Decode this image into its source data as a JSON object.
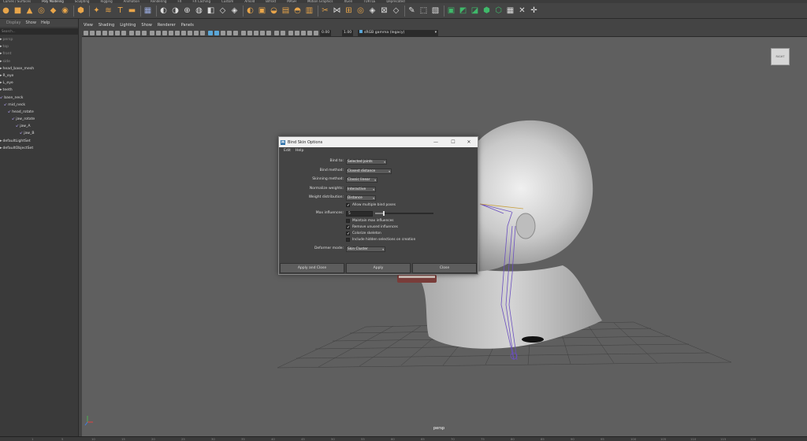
{
  "shelf_tabs": [
    "Curves / Surfaces",
    "Poly Modeling",
    "Sculpting",
    "Rigging",
    "Animation",
    "Rendering",
    "FX",
    "FX Caching",
    "Custom",
    "Arnold",
    "Bifrost",
    "MASH",
    "Motion Graphics",
    "XGen",
    "TURTLE",
    "Deprecated"
  ],
  "shelf_active_index": 1,
  "outliner": {
    "menu": [
      "Display",
      "Show",
      "Help"
    ],
    "search_placeholder": "Search...",
    "items": [
      {
        "label": "persp",
        "dim": true,
        "indent": 0,
        "joint": false
      },
      {
        "label": "top",
        "dim": true,
        "indent": 0,
        "joint": false
      },
      {
        "label": "front",
        "dim": true,
        "indent": 0,
        "joint": false
      },
      {
        "label": "side",
        "dim": true,
        "indent": 0,
        "joint": false
      },
      {
        "label": "head_base_mesh",
        "dim": false,
        "indent": 0,
        "joint": false
      },
      {
        "label": "R_eye",
        "dim": false,
        "indent": 0,
        "joint": false
      },
      {
        "label": "L_eye",
        "dim": false,
        "indent": 0,
        "joint": false
      },
      {
        "label": "teeth",
        "dim": false,
        "indent": 0,
        "joint": false
      },
      {
        "label": "base_neck",
        "dim": false,
        "indent": 0,
        "joint": true
      },
      {
        "label": "mid_neck",
        "dim": false,
        "indent": 1,
        "joint": true
      },
      {
        "label": "head_rotate",
        "dim": false,
        "indent": 2,
        "joint": true
      },
      {
        "label": "jaw_rotate",
        "dim": false,
        "indent": 3,
        "joint": true
      },
      {
        "label": "jaw_A",
        "dim": false,
        "indent": 4,
        "joint": true
      },
      {
        "label": "jaw_B",
        "dim": false,
        "indent": 5,
        "joint": true
      },
      {
        "label": "defaultLightSet",
        "dim": false,
        "indent": 0,
        "joint": false
      },
      {
        "label": "defaultObjectSet",
        "dim": false,
        "indent": 0,
        "joint": false
      }
    ]
  },
  "viewport": {
    "menu": [
      "View",
      "Shading",
      "Lighting",
      "Show",
      "Renderer",
      "Panels"
    ],
    "exposure": "0.00",
    "gamma": "1.00",
    "colorspace": "sRGB gamma (legacy)",
    "camera": "persp",
    "viewcube_label": "RIGHT"
  },
  "timeline_ticks": [
    "1",
    "5",
    "10",
    "15",
    "20",
    "25",
    "30",
    "35",
    "40",
    "45",
    "50",
    "55",
    "60",
    "65",
    "70",
    "75",
    "80",
    "85",
    "90",
    "95",
    "100",
    "105",
    "110",
    "115",
    "120"
  ],
  "dialog": {
    "title": "Bind Skin Options",
    "menu": [
      "Edit",
      "Help"
    ],
    "fields": {
      "bind_to": {
        "label": "Bind to:",
        "value": "Selected joints"
      },
      "bind_method": {
        "label": "Bind method:",
        "value": "Closest distance"
      },
      "skinning_method": {
        "label": "Skinning method:",
        "value": "Classic linear"
      },
      "normalize_weights": {
        "label": "Normalize weights:",
        "value": "Interactive"
      },
      "weight_distribution": {
        "label": "Weight distribution:",
        "value": "Distance"
      },
      "max_influences": {
        "label": "Max influences:",
        "value": "5",
        "slider_fraction": 0.13
      },
      "deformer_mode": {
        "label": "Deformer mode:",
        "value": "Skin Cluster"
      }
    },
    "checkboxes": [
      {
        "label": "Allow multiple bind poses",
        "checked": true
      },
      {
        "label": "Maintain max influences",
        "checked": false
      },
      {
        "label": "Remove unused influences",
        "checked": true
      },
      {
        "label": "Colorize skeleton",
        "checked": true
      },
      {
        "label": "Include hidden selections on creation",
        "checked": false
      }
    ],
    "buttons": {
      "apply_close": "Apply and Close",
      "apply": "Apply",
      "close": "Close"
    }
  }
}
